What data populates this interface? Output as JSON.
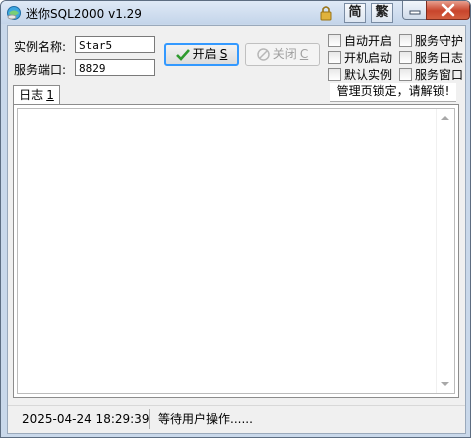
{
  "window": {
    "title": "迷你SQL2000 v1.29",
    "simplified_label": "简",
    "traditional_label": "繁",
    "icons": {
      "app": "app-globe-icon",
      "lock": "lock-icon",
      "minimize": "minimize-icon",
      "close": "close-icon"
    }
  },
  "form": {
    "instance_label": "实例名称:",
    "instance_value": "Star5",
    "port_label": "服务端口:",
    "port_value": "8829"
  },
  "buttons": {
    "start_label": "开启",
    "start_key": "S",
    "stop_label": "关闭",
    "stop_key": "C"
  },
  "options": {
    "auto_start": "自动开启",
    "boot_start": "开机启动",
    "default_instance": "默认实例",
    "service_guard": "服务守护",
    "service_log": "服务日志",
    "service_window": "服务窗口"
  },
  "tabs": {
    "log_label": "日志",
    "log_key": "1"
  },
  "lock_message": "管理页锁定，请解锁!",
  "status": {
    "datetime": "2025-04-24 18:29:39",
    "message": "等待用户操作......"
  },
  "colors": {
    "accent": "#3399ff",
    "start_check": "#2e9a2e",
    "close_red": "#c8452c"
  }
}
